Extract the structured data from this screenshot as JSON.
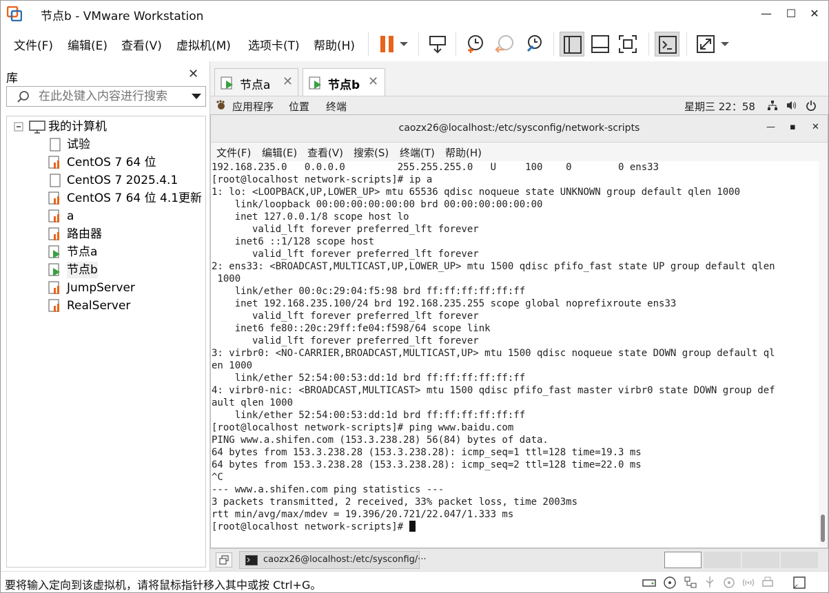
{
  "window": {
    "title": "节点b - VMware Workstation",
    "min": "—",
    "max": "☐",
    "close": "✕"
  },
  "menu": [
    "文件(F)",
    "编辑(E)",
    "查看(V)",
    "虚拟机(M)",
    "选项卡(T)",
    "帮助(H)"
  ],
  "toolbar": {
    "icons": [
      "pause-icon",
      "dropdown-icon",
      "send-keys-icon",
      "snapshot-icon",
      "revert-snapshot-icon",
      "snapshot-manager-icon",
      "library-view-icon",
      "thumbnail-view-icon",
      "fullscreen-icon",
      "console-icon",
      "stretch-icon"
    ]
  },
  "library": {
    "title": "库",
    "close": "✕",
    "search_placeholder": "在此处键入内容进行搜索",
    "root": "我的计算机",
    "items": [
      "试验",
      "CentOS 7 64 位",
      "CentOS 7 2025.4.1",
      "CentOS 7 64 位 4.1更新",
      "a",
      "路由器",
      "节点a",
      "节点b",
      "JumpServer",
      "RealServer"
    ]
  },
  "tabs": [
    {
      "label": "节点a",
      "close": "✕"
    },
    {
      "label": "节点b",
      "close": "✕"
    }
  ],
  "gnome": {
    "apps": "应用程序",
    "places": "位置",
    "terminal": "终端",
    "clock": "星期三 22：58"
  },
  "terminal": {
    "title": "caozx26@localhost:/etc/sysconfig/network-scripts",
    "min": "—",
    "max": "▪",
    "close": "✕",
    "menu": [
      "文件(F)",
      "编辑(E)",
      "查看(V)",
      "搜索(S)",
      "终端(T)",
      "帮助(H)"
    ],
    "lines": [
      "192.168.235.0   0.0.0.0         255.255.255.0   U     100    0        0 ens33",
      "[root@localhost network-scripts]# ip a",
      "1: lo: <LOOPBACK,UP,LOWER_UP> mtu 65536 qdisc noqueue state UNKNOWN group default qlen 1000",
      "    link/loopback 00:00:00:00:00:00 brd 00:00:00:00:00:00",
      "    inet 127.0.0.1/8 scope host lo",
      "       valid_lft forever preferred_lft forever",
      "    inet6 ::1/128 scope host",
      "       valid_lft forever preferred_lft forever",
      "2: ens33: <BROADCAST,MULTICAST,UP,LOWER_UP> mtu 1500 qdisc pfifo_fast state UP group default qlen",
      " 1000",
      "    link/ether 00:0c:29:04:f5:98 brd ff:ff:ff:ff:ff:ff",
      "    inet 192.168.235.100/24 brd 192.168.235.255 scope global noprefixroute ens33",
      "       valid_lft forever preferred_lft forever",
      "    inet6 fe80::20c:29ff:fe04:f598/64 scope link",
      "       valid_lft forever preferred_lft forever",
      "3: virbr0: <NO-CARRIER,BROADCAST,MULTICAST,UP> mtu 1500 qdisc noqueue state DOWN group default ql",
      "en 1000",
      "    link/ether 52:54:00:53:dd:1d brd ff:ff:ff:ff:ff:ff",
      "4: virbr0-nic: <BROADCAST,MULTICAST> mtu 1500 qdisc pfifo_fast master virbr0 state DOWN group def",
      "ault qlen 1000",
      "    link/ether 52:54:00:53:dd:1d brd ff:ff:ff:ff:ff:ff",
      "[root@localhost network-scripts]# ping www.baidu.com",
      "PING www.a.shifen.com (153.3.238.28) 56(84) bytes of data.",
      "64 bytes from 153.3.238.28 (153.3.238.28): icmp_seq=1 ttl=128 time=19.3 ms",
      "64 bytes from 153.3.238.28 (153.3.238.28): icmp_seq=2 ttl=128 time=22.0 ms",
      "^C",
      "--- www.a.shifen.com ping statistics ---",
      "3 packets transmitted, 2 received, 33% packet loss, time 2003ms",
      "rtt min/avg/max/mdev = 19.396/20.721/22.047/1.333 ms"
    ],
    "prompt": "[root@localhost network-scripts]# "
  },
  "taskbar": {
    "task": "caozx26@localhost:/etc/sysconfig/···"
  },
  "status": {
    "text": "要将输入定向到该虚拟机，请将鼠标指针移入其中或按 Ctrl+G。"
  },
  "colors": {
    "accent": "#e8641b",
    "play": "#3aa142"
  }
}
